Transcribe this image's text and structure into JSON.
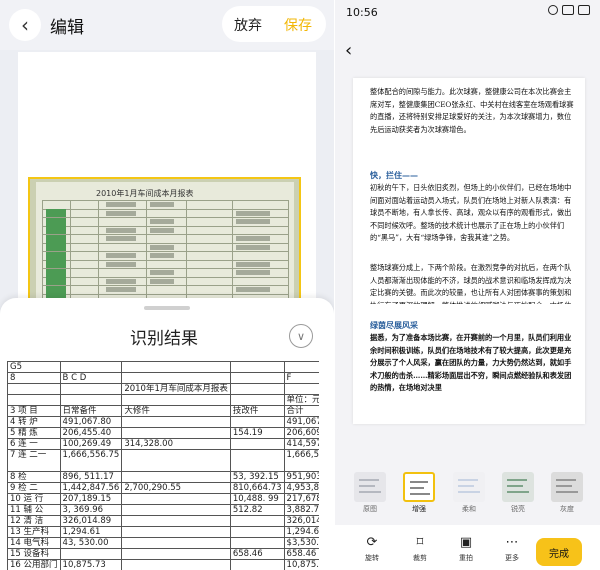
{
  "left": {
    "header": {
      "back_icon": "chevron-left-icon",
      "title": "编辑",
      "discard": "放弃",
      "save": "保存",
      "accent": "#f2b707"
    },
    "photo": {
      "title": "2010年1月车间成本月报表"
    },
    "result": {
      "title": "识别结果",
      "collapse_icon": "chevron-down-circle-icon",
      "table": {
        "rows": [
          [
            "G5",
            "",
            "",
            "",
            ""
          ],
          [
            "8",
            "B C D",
            "",
            "",
            "F"
          ],
          [
            "",
            "",
            "2010年1月车间成本月报表",
            "",
            ""
          ],
          [
            "",
            "",
            "",
            "",
            "单位：元"
          ],
          [
            "3 项 目",
            "日常备件",
            "大修件",
            "技改件",
            "合计"
          ],
          [
            "4 转 炉",
            "491,067.80",
            "",
            "",
            "491,067.80"
          ],
          [
            "5 精 炼",
            "206,455.40",
            "",
            "154.19",
            "206,609.59"
          ],
          [
            "6 连 一",
            "100,269.49",
            "314,328.00",
            "",
            "414,597.49"
          ],
          [
            "7 连 二一",
            "1,666,556.75",
            "",
            "",
            "1,666,556.75"
          ],
          [
            "8 检",
            "896, 511.17",
            "",
            "53, 392.15",
            "951,903.32"
          ],
          [
            "9 检 二",
            "1,442,847.56",
            "2,700,290.55",
            "810,664.73",
            "4,953,802.84"
          ],
          [
            "10 运 行",
            "207,189.15",
            "",
            "10,488. 99",
            "217,678.14"
          ],
          [
            "11 辅 公",
            "3, 369.96",
            "",
            "512.82",
            "3,882.78"
          ],
          [
            "12 清 洁",
            "326,014.89",
            "",
            "",
            "326,014.89"
          ],
          [
            "13 生产科",
            "1,294.61",
            "",
            "",
            "1,294.61"
          ],
          [
            "14 电气科",
            "43, 530.00",
            "",
            "",
            "$3,530.00"
          ],
          [
            "15 设备科",
            "",
            "",
            "658.46",
            "658.46"
          ],
          [
            "16 公用部门",
            "10,875.73",
            "",
            "",
            "10,875.73"
          ]
        ]
      }
    }
  },
  "right": {
    "status": {
      "time": "10:56"
    },
    "back_icon": "arrow-left-icon",
    "page": {
      "p1": "整体配合的间隙与能力。此次球赛，整健康公司在本次比赛会主席对军，整健康集团CEO张永红、中关村在线客室在场观看球赛的直播，还将特别安排足球爱好的关注，为本次球赛增力，数位先后运动获奖者为次球赛增色。",
      "h1": "快，拦住——",
      "p2": "初秋的午下，日头依旧炙烈，但场上的小伙伴们，已经在场地中间面对面站着运动员入场式，队员们在场地上对新人队表演：有球员不断地，有人拿长传、高球，观众以有序的观看形式，做出不同时候欢呼。整场的技术统计也展示了正在场上的小伙伴们的“黑马”，大有“绿场争锋，舍我其谁”之势。",
      "p3": "整场球赛分成上，下两个阶段。在激烈竞争的对抗后，在两个队人员都渐渐出现体能的不济，球员的战术意识和临场发挥成为决定比赛的关键。而此次的较量，也让所有人对团体赛事的策划和执行有了更深的理解，整体推进的细腻脚法与巧妙配合，中场休息时间，双方队员也都共同鼓舞士气，最终为活动画下一个圆满的句号。",
      "h2": "绿茵尽展风采",
      "p4": "据悉，为了准备本场比赛，在开赛前的一个月里，队员们利用业余时间积极训练，队员们在场地技术有了较大提高，此次更是充分展示了个人风采，赢在团队的力量，力大势仍然达到，就如手术刀般的击杀……精彩场面层出不穷，瞬间点燃经验队和表发团的热情，在场地对决里"
    },
    "filters": [
      "原图",
      "增强",
      "柔和",
      "锐亮",
      "灰度"
    ],
    "active_filter": "增强",
    "toolbar": {
      "rotate": {
        "icon": "rotate-icon",
        "label": "旋转"
      },
      "crop": {
        "icon": "crop-icon",
        "label": "裁剪"
      },
      "retake": {
        "icon": "camera-icon",
        "label": "重拍"
      },
      "more": {
        "icon": "more-dots-icon",
        "label": "更多"
      },
      "done": "完成"
    },
    "accent": "#f7c219"
  }
}
